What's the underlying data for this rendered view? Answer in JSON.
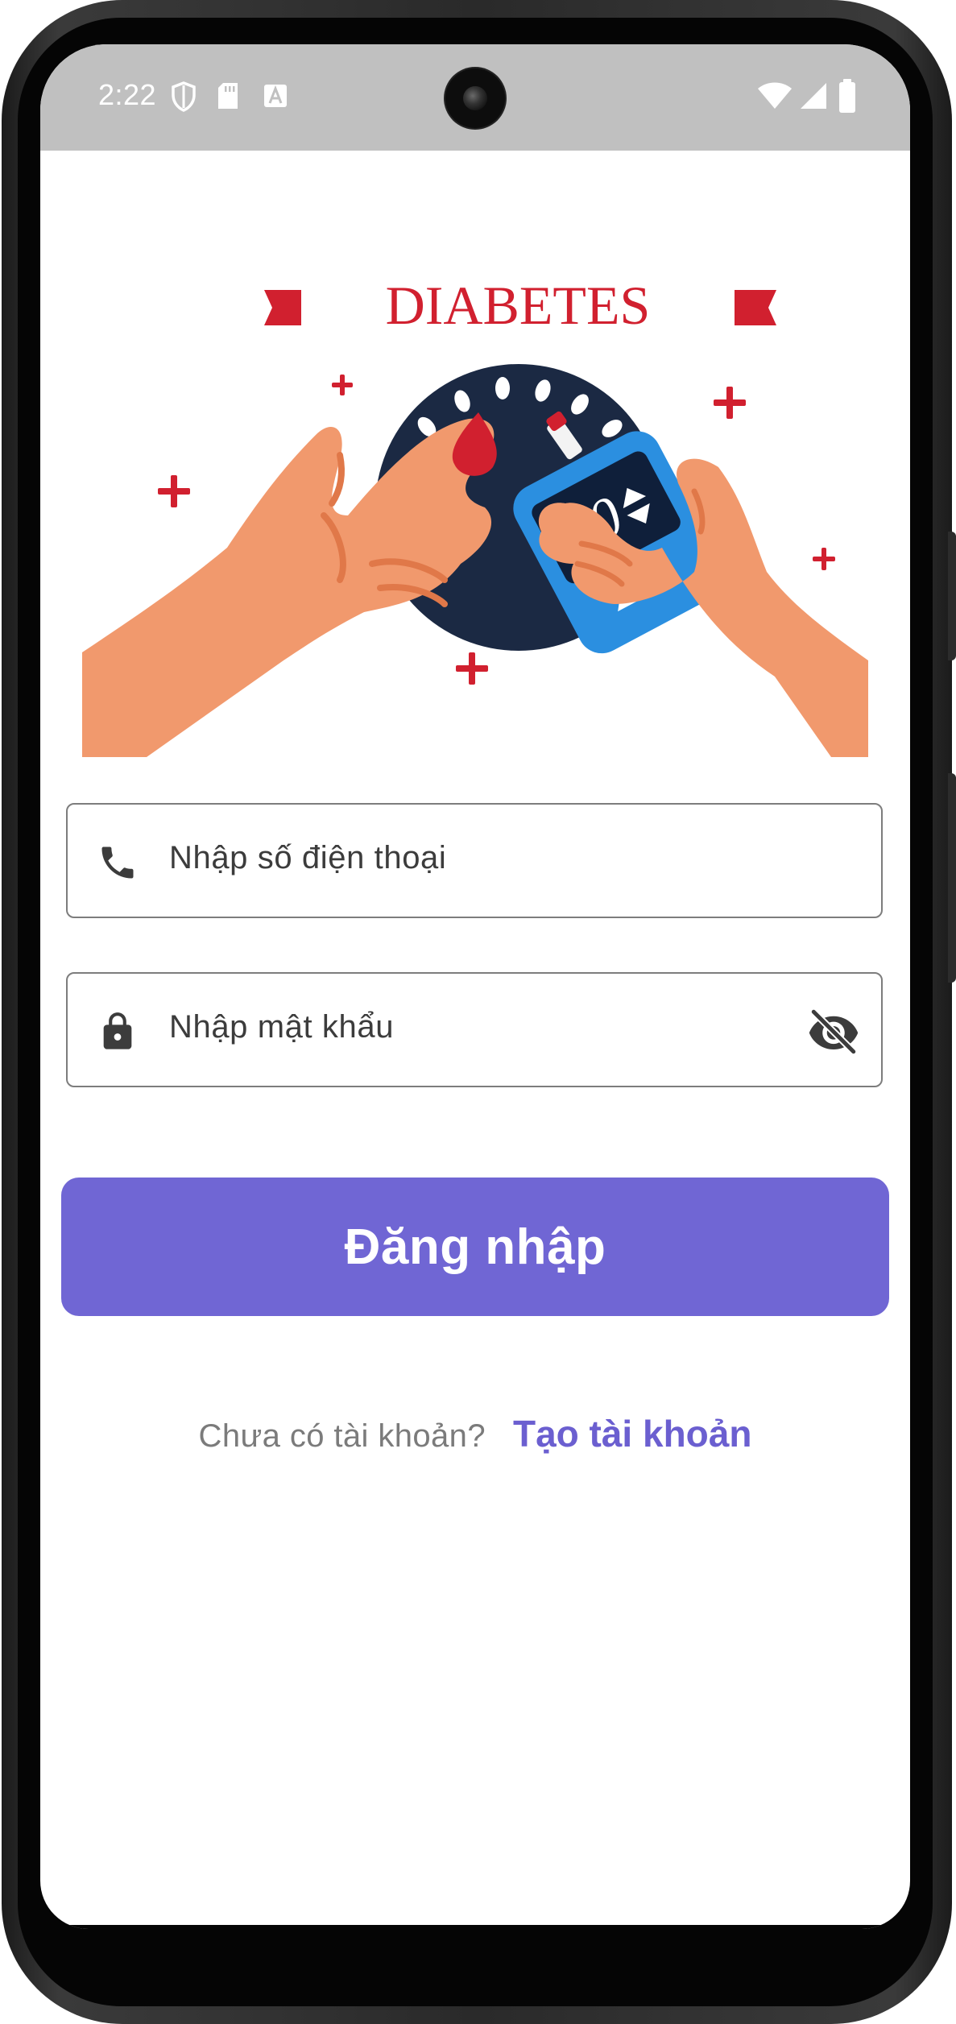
{
  "status_bar": {
    "time": "2:22",
    "left_icons": [
      "shield-icon",
      "sd-card-icon",
      "text-a-icon"
    ],
    "right_icons": [
      "wifi-icon",
      "signal-icon",
      "battery-icon"
    ],
    "background": "#c0c0c0"
  },
  "hero": {
    "banner_text": "DIABETES",
    "meter_reading": "80",
    "icon_name": "glucose-meter-illustration"
  },
  "form": {
    "phone_field": {
      "placeholder": "Nhập số điện thoại",
      "icon": "phone-icon"
    },
    "password_field": {
      "placeholder": "Nhập mật khẩu",
      "icon": "lock-icon",
      "toggle_icon": "eye-off-icon"
    },
    "login_button": {
      "label": "Đăng nhập",
      "color": "#7066d4"
    }
  },
  "signup": {
    "question": "Chưa có tài khoản?",
    "link_label": "Tạo tài khoản",
    "link_color": "#6b5fd0"
  }
}
